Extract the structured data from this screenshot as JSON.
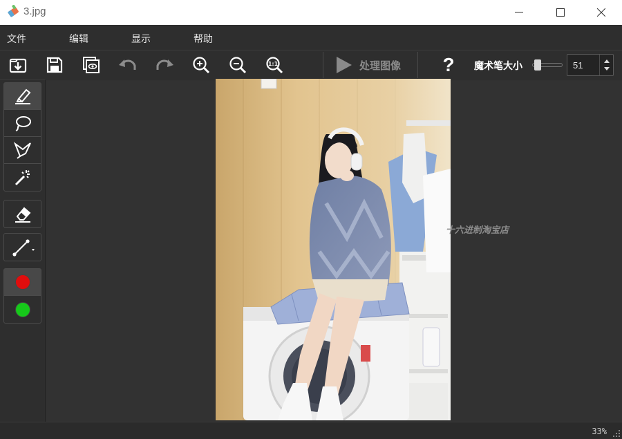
{
  "window": {
    "title": "3.jpg"
  },
  "menu": [
    {
      "label": "文件"
    },
    {
      "label": "编辑"
    },
    {
      "label": "显示"
    },
    {
      "label": "帮助"
    }
  ],
  "toolbar": {
    "process_label": "处理图像",
    "help_label": "?",
    "brush_size_label": "魔术笔大小",
    "brush_size_value": "51",
    "brush_size_fraction": 0.1,
    "icons": [
      "import-icon",
      "save-icon",
      "preview-icon",
      "undo-icon",
      "redo-icon",
      "zoom-in-icon",
      "zoom-out-icon",
      "zoom-actual-icon",
      "play-icon"
    ]
  },
  "tools": {
    "icons": [
      "marker-icon",
      "lasso-icon",
      "polygon-lasso-icon",
      "magic-wand-icon",
      "eraser-icon",
      "line-icon"
    ],
    "colors": {
      "red": "#e00d0d",
      "green": "#16c91a"
    }
  },
  "canvas": {
    "watermark": "十六进制淘宝店"
  },
  "status": {
    "zoom": "33%"
  },
  "colors": {
    "background": "#2b2b2b",
    "panel": "#2e2e2e",
    "canvas": "#323232",
    "accent_text": "#ffffff"
  }
}
